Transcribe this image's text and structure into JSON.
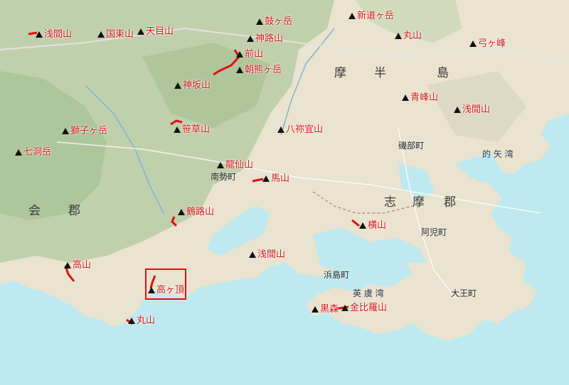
{
  "peaks": [
    {
      "id": "asamayama-n",
      "name": "浅間山"
    },
    {
      "id": "kokuzosan",
      "name": "国束山"
    },
    {
      "id": "tenmokusan",
      "name": "天目山"
    },
    {
      "id": "tsuzumigatake",
      "name": "鼓ヶ岳"
    },
    {
      "id": "shinmichigatake",
      "name": "新道ヶ岳"
    },
    {
      "id": "kamijisan",
      "name": "神路山"
    },
    {
      "id": "maeyama",
      "name": "前山"
    },
    {
      "id": "asamagatake",
      "name": "朝熊ヶ岳"
    },
    {
      "id": "maruyama-n",
      "name": "丸山"
    },
    {
      "id": "yumigamine",
      "name": "弓ヶ峰"
    },
    {
      "id": "kamisakayama",
      "name": "神坂山"
    },
    {
      "id": "aomineyama",
      "name": "青峰山"
    },
    {
      "id": "asamayama-e",
      "name": "浅間山"
    },
    {
      "id": "shishigatake",
      "name": "獅子ヶ岳"
    },
    {
      "id": "sasakusayama",
      "name": "笹草山"
    },
    {
      "id": "shichidogatake",
      "name": "七洞岳"
    },
    {
      "id": "yasokureyama",
      "name": "八祢宜山"
    },
    {
      "id": "ryusenzan",
      "name": "龍仙山"
    },
    {
      "id": "umayama",
      "name": "馬山"
    },
    {
      "id": "tsurumichiyama",
      "name": "鶴路山"
    },
    {
      "id": "yokoyama",
      "name": "横山"
    },
    {
      "id": "asamayama-s",
      "name": "浅間山"
    },
    {
      "id": "takayama",
      "name": "高山"
    },
    {
      "id": "takagacho",
      "name": "高ヶ頂"
    },
    {
      "id": "kurimori",
      "name": "黒森"
    },
    {
      "id": "konpirayama",
      "name": "金比羅山"
    },
    {
      "id": "maruyama-s",
      "name": "丸山"
    }
  ],
  "regions": {
    "shima_hanto": [
      "摩",
      "半",
      "島"
    ],
    "shima_gun": [
      "志",
      "摩",
      "郡"
    ],
    "watarai_gun": [
      "会",
      "郡"
    ]
  },
  "towns": {
    "minamise": "南勢町",
    "hamajima": "浜島町",
    "ago": "阿児町",
    "daio": "大王町",
    "isobe": "磯部町"
  },
  "bays": {
    "ago_bay": "英 虞 湾",
    "matoya": "的 矢 湾"
  }
}
